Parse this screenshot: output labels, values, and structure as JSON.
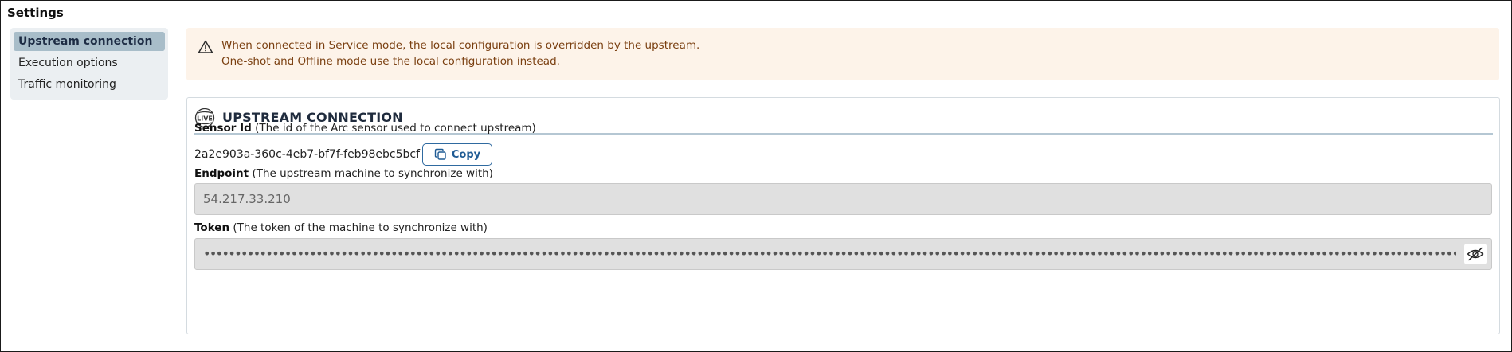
{
  "page": {
    "title": "Settings"
  },
  "sidebar": {
    "items": [
      {
        "label": "Upstream connection",
        "active": true
      },
      {
        "label": "Execution options",
        "active": false
      },
      {
        "label": "Traffic monitoring",
        "active": false
      }
    ]
  },
  "warning": {
    "icon": "warning-triangle-icon",
    "line1": "When connected in Service mode, the local configuration is overridden by the upstream.",
    "line2": "One-shot and Offline mode use the local configuration instead."
  },
  "panel": {
    "icon": "live-globe-icon",
    "title": "UPSTREAM CONNECTION",
    "sensor": {
      "label": "Sensor Id",
      "hint": "(The id of the Arc sensor used to connect upstream)",
      "value": "2a2e903a-360c-4eb7-bf7f-feb98ebc5bcf",
      "copy_label": "Copy"
    },
    "endpoint": {
      "label": "Endpoint",
      "hint": "(The upstream machine to synchronize with)",
      "value": "54.217.33.210"
    },
    "token": {
      "label": "Token",
      "hint": "(The token of the machine to synchronize with)",
      "masked_value": "••••••••••••••••••••••••••••••••••••••••••••••••••••••••••••••••••••••••••••••••••••••••••••••••••••••••••••••••••••••••••••••••••••••••••••••••••••••••••••••••••••••••••••••••••••••••••••••••••••••••••••••••••••••••••••••••••••••••••••••••••••••••••••••••••••••••••••••••••••••••••••••",
      "toggle_icon": "eye-slash-icon"
    }
  },
  "colors": {
    "sidebar_bg": "#ebeff2",
    "sidebar_active": "#a8bdc9",
    "warning_bg": "#fdf3e9",
    "warning_text": "#7a3f10",
    "accent": "#1f5b94"
  }
}
